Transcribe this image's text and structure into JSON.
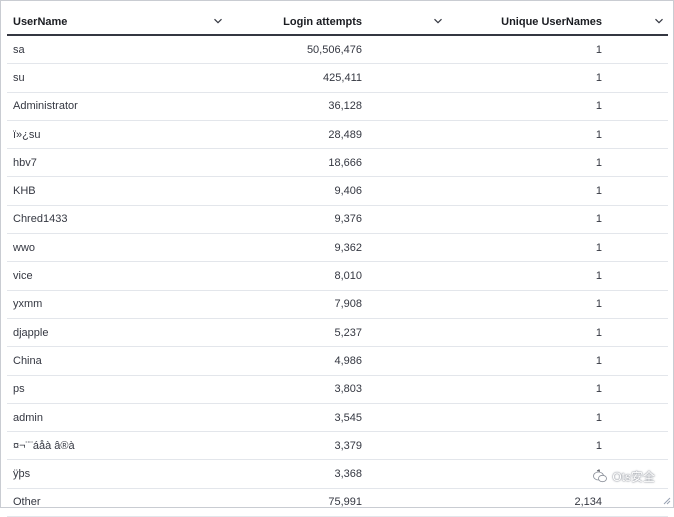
{
  "columns": [
    {
      "label": "UserName"
    },
    {
      "label": "Login attempts"
    },
    {
      "label": "Unique UserNames"
    }
  ],
  "rows": [
    {
      "username": "sa",
      "attempts": "50,506,476",
      "unique": "1"
    },
    {
      "username": "su",
      "attempts": "425,411",
      "unique": "1"
    },
    {
      "username": "Administrator",
      "attempts": "36,128",
      "unique": "1"
    },
    {
      "username": "ï»¿su",
      "attempts": "28,489",
      "unique": "1"
    },
    {
      "username": "hbv7",
      "attempts": "18,666",
      "unique": "1"
    },
    {
      "username": "KHB",
      "attempts": "9,406",
      "unique": "1"
    },
    {
      "username": "Chred1433",
      "attempts": "9,376",
      "unique": "1"
    },
    {
      "username": "wwo",
      "attempts": "9,362",
      "unique": "1"
    },
    {
      "username": "vice",
      "attempts": "8,010",
      "unique": "1"
    },
    {
      "username": "yxmm",
      "attempts": "7,908",
      "unique": "1"
    },
    {
      "username": "djapple",
      "attempts": "5,237",
      "unique": "1"
    },
    {
      "username": "China",
      "attempts": "4,986",
      "unique": "1"
    },
    {
      "username": "ps",
      "attempts": "3,803",
      "unique": "1"
    },
    {
      "username": "admin",
      "attempts": "3,545",
      "unique": "1"
    },
    {
      "username": "¤¬¨¨áåà â®à",
      "attempts": "3,379",
      "unique": "1"
    },
    {
      "username": "ÿþs",
      "attempts": "3,368",
      "unique": "1"
    },
    {
      "username": "Other",
      "attempts": "75,991",
      "unique": "2,134"
    }
  ],
  "watermark": {
    "text": "Ots安全",
    "icon": "wechat-icon"
  },
  "colors": {
    "header_text": "#1a1c21",
    "body_text": "#343741",
    "row_border": "#e3e6eb",
    "header_border": "#343741"
  }
}
